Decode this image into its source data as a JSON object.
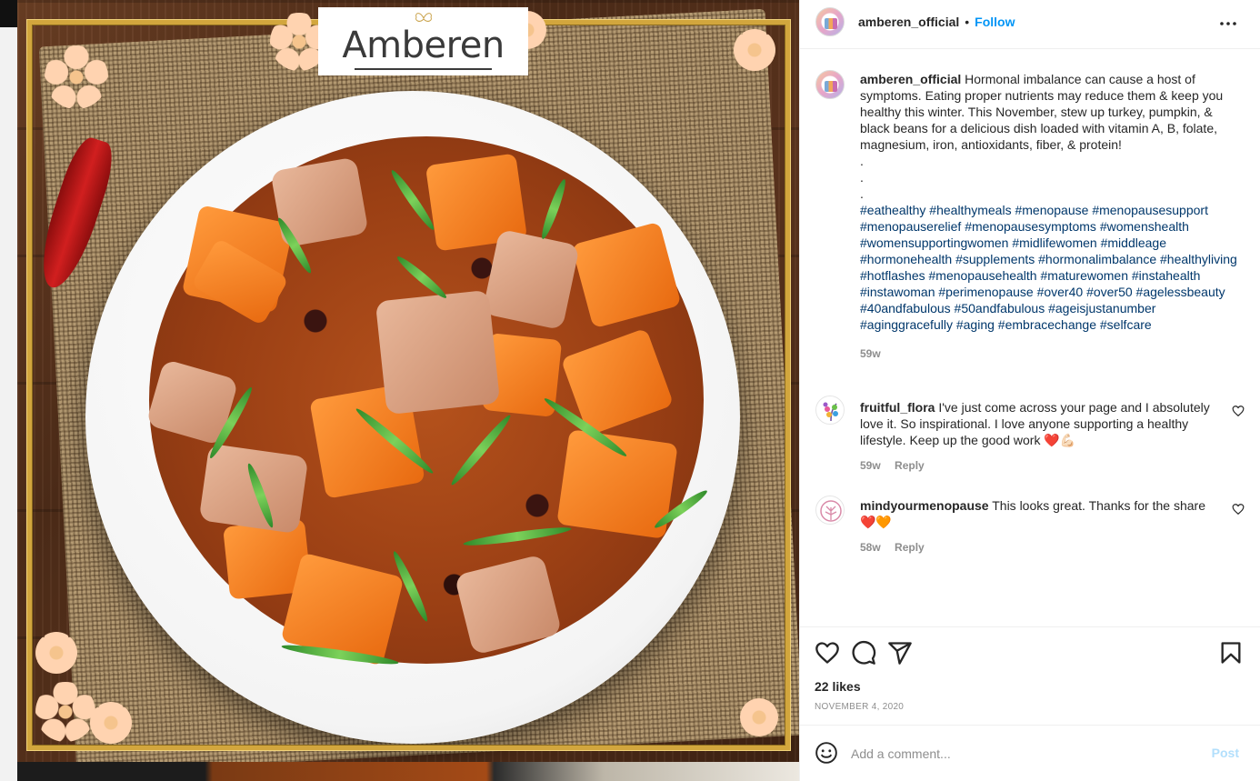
{
  "post_image": {
    "logo_text": "Amberen"
  },
  "header": {
    "username": "amberen_official",
    "separator": "•",
    "follow_label": "Follow"
  },
  "caption": {
    "username": "amberen_official",
    "text": "Hormonal imbalance can cause a host of symptoms. Eating proper nutrients may reduce them & keep you healthy this winter. This November, stew up turkey, pumpkin, & black beans for a delicious dish loaded with vitamin A, B, folate, magnesium, iron, antioxidants, fiber, & protein!",
    "dots": [
      ".",
      ".",
      "."
    ],
    "hashtags": [
      "#eathealthy",
      "#healthymeals",
      "#menopause",
      "#menopausesupport",
      "#menopauserelief",
      "#menopausesymptoms",
      "#womenshealth",
      "#womensupportingwomen",
      "#midlifewomen",
      "#middleage",
      "#hormonehealth",
      "#supplements",
      "#hormonalimbalance",
      "#healthyliving",
      "#hotflashes",
      "#menopausehealth",
      "#maturewomen",
      "#instahealth",
      "#instawoman",
      "#perimenopause",
      "#over40",
      "#over50",
      "#agelessbeauty",
      "#40andfabulous",
      "#50andfabulous",
      "#ageisjustanumber",
      "#aginggracefully",
      "#aging",
      "#embracechange",
      "#selfcare"
    ],
    "time": "59w"
  },
  "comments": [
    {
      "username": "fruitful_flora",
      "text": "I've just come across your page and I absolutely love it. So inspirational. I love anyone supporting a healthy lifestyle. Keep up the good work ❤️💪🏻",
      "time": "59w",
      "reply_label": "Reply"
    },
    {
      "username": "mindyourmenopause",
      "text": "This looks great. Thanks for the share ❤️🧡",
      "time": "58w",
      "reply_label": "Reply"
    }
  ],
  "actions": {
    "likes": "22 likes",
    "date": "NOVEMBER 4, 2020"
  },
  "add_comment": {
    "placeholder": "Add a comment...",
    "post_label": "Post"
  },
  "icons": {
    "more": "more-horizontal-icon",
    "like": "heart-icon",
    "comment": "comment-icon",
    "share": "paper-plane-icon",
    "save": "bookmark-icon",
    "emoji": "emoji-smile-icon",
    "comment_like": "heart-small-icon"
  },
  "colors": {
    "link_blue": "#0095f6",
    "hashtag": "#00376b",
    "muted": "#8e8e8e",
    "post_disabled": "#b2dffc",
    "frame_gold": "#d2a63d"
  }
}
